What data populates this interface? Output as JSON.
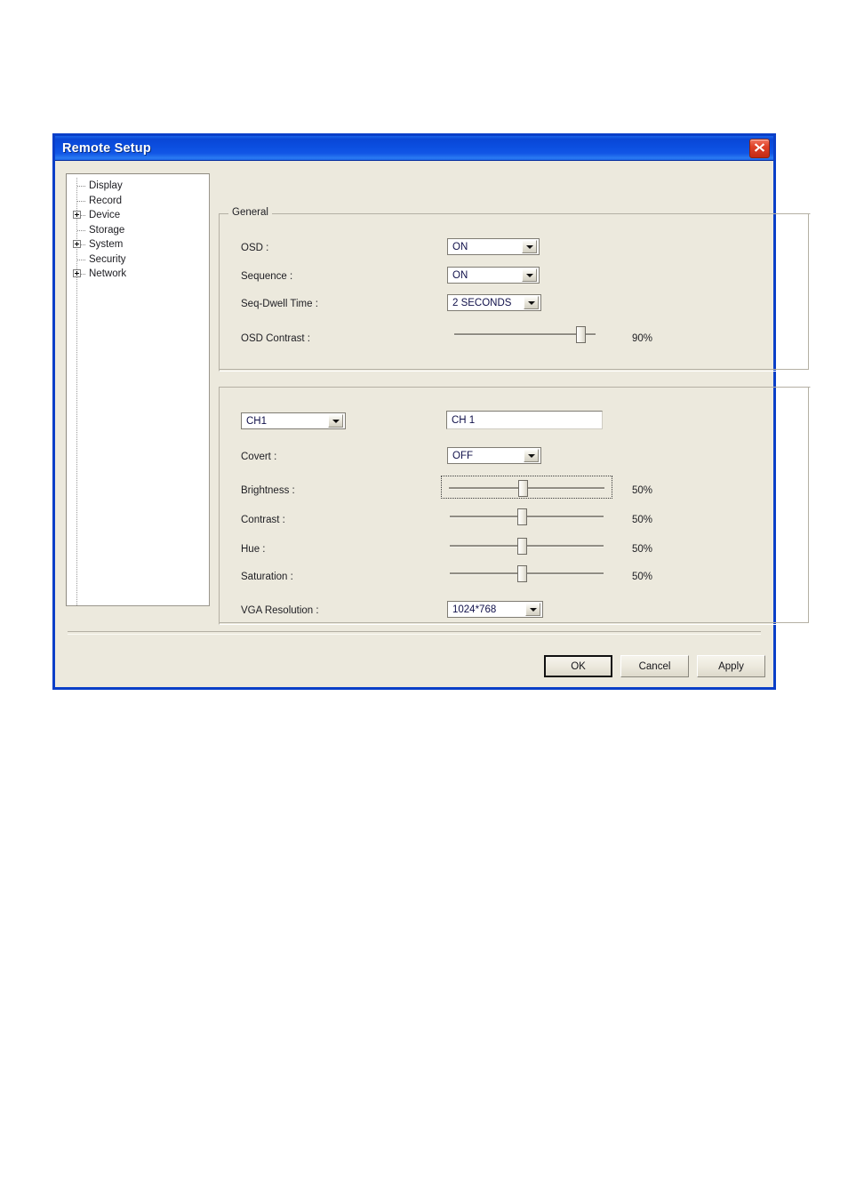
{
  "window": {
    "title": "Remote Setup",
    "close_icon": "close-x-icon"
  },
  "sidebar": {
    "items": [
      {
        "label": "Display",
        "expandable": false
      },
      {
        "label": "Record",
        "expandable": false
      },
      {
        "label": "Device",
        "expandable": true
      },
      {
        "label": "Storage",
        "expandable": false
      },
      {
        "label": "System",
        "expandable": true
      },
      {
        "label": "Security",
        "expandable": false
      },
      {
        "label": "Network",
        "expandable": true
      }
    ]
  },
  "general": {
    "title": "General",
    "osd": {
      "label": "OSD :",
      "value": "ON"
    },
    "sequence": {
      "label": "Sequence :",
      "value": "ON"
    },
    "seq_dwell_time": {
      "label": "Seq-Dwell Time :",
      "value": "2 SECONDS"
    },
    "osd_contrast": {
      "label": "OSD Contrast :",
      "value": "90%",
      "percent": 90
    }
  },
  "channel": {
    "selector": {
      "value": "CH1"
    },
    "name_field": {
      "value": "CH 1"
    },
    "covert": {
      "label": "Covert :",
      "value": "OFF"
    },
    "brightness": {
      "label": "Brightness :",
      "value": "50%",
      "percent": 50
    },
    "contrast": {
      "label": "Contrast :",
      "value": "50%",
      "percent": 50
    },
    "hue": {
      "label": "Hue :",
      "value": "50%",
      "percent": 50
    },
    "saturation": {
      "label": "Saturation :",
      "value": "50%",
      "percent": 50
    },
    "vga_resolution": {
      "label": "VGA Resolution :",
      "value": "1024*768"
    }
  },
  "footer": {
    "ok": "OK",
    "cancel": "Cancel",
    "apply": "Apply"
  },
  "colors": {
    "dialog_bg": "#ece9dd",
    "title_blue": "#0a47d6",
    "border_blue": "#0a3fc8",
    "close_red": "#e0432a"
  }
}
